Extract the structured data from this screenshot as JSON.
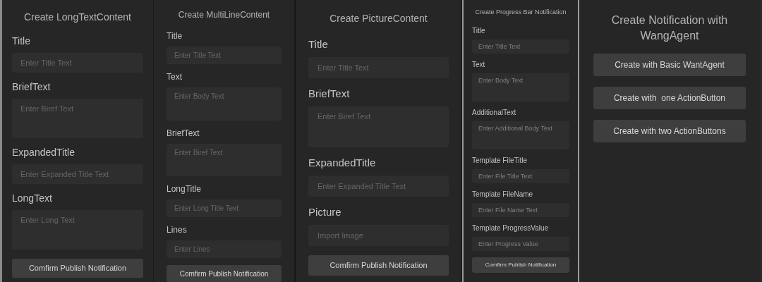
{
  "panels": [
    {
      "title": "Create LongTextContent",
      "fields": [
        {
          "label": "Title",
          "kind": "line",
          "placeholder": "Enter Title Text"
        },
        {
          "label": "BriefText",
          "kind": "area",
          "placeholder": "Enter Biref Text"
        },
        {
          "label": "ExpandedTitle",
          "kind": "line",
          "placeholder": "Enter Expanded Title Text"
        },
        {
          "label": "LongText",
          "kind": "area",
          "placeholder": "Enter Long Text"
        }
      ],
      "buttons": [
        "Comfirm Publish Notification"
      ]
    },
    {
      "title": "Create MultiLineContent",
      "fields": [
        {
          "label": "Title",
          "kind": "line",
          "placeholder": "Enter Title Text"
        },
        {
          "label": "Text",
          "kind": "area",
          "placeholder": "Enter Body Text"
        },
        {
          "label": "BriefText",
          "kind": "area",
          "placeholder": "Enter Biref Text"
        },
        {
          "label": "LongTitle",
          "kind": "line",
          "placeholder": "Enter Long Title Text"
        },
        {
          "label": "Lines",
          "kind": "line",
          "placeholder": "Enter Lines"
        }
      ],
      "buttons": [
        "Comfirm Publish Notification"
      ]
    },
    {
      "title": "Create PictureContent",
      "fields": [
        {
          "label": "Title",
          "kind": "line",
          "placeholder": "Enter Title Text"
        },
        {
          "label": "BriefText",
          "kind": "area",
          "placeholder": "Enter Biref Text"
        },
        {
          "label": "ExpandedTitle",
          "kind": "line",
          "placeholder": "Enter Expanded Title Text"
        },
        {
          "label": "Picture",
          "kind": "line",
          "placeholder": "Import Image"
        }
      ],
      "buttons": [
        "Comfirm Publish Notification"
      ]
    },
    {
      "title": "Create Progress Bar Notification",
      "fields": [
        {
          "label": "Title",
          "kind": "line",
          "placeholder": "Enter Title Text"
        },
        {
          "label": "Text",
          "kind": "area",
          "placeholder": "Enter Body Text"
        },
        {
          "label": "AdditionalText",
          "kind": "area",
          "placeholder": "Enter Additional Body Text"
        },
        {
          "label": "Template FileTitle",
          "kind": "line",
          "placeholder": "Enter File Title Text"
        },
        {
          "label": "Template FileName",
          "kind": "line",
          "placeholder": "Enter File Name Text"
        },
        {
          "label": "Template ProgressValue",
          "kind": "line",
          "placeholder": "Enter Progress Value"
        }
      ],
      "buttons": [
        "Comfirm Publish Notification"
      ]
    },
    {
      "title": "Create Notification with WangAgent",
      "buttons": [
        "Create with Basic WantAgent",
        "Create with  one ActionButton",
        "Create with two ActionButtons"
      ]
    }
  ]
}
